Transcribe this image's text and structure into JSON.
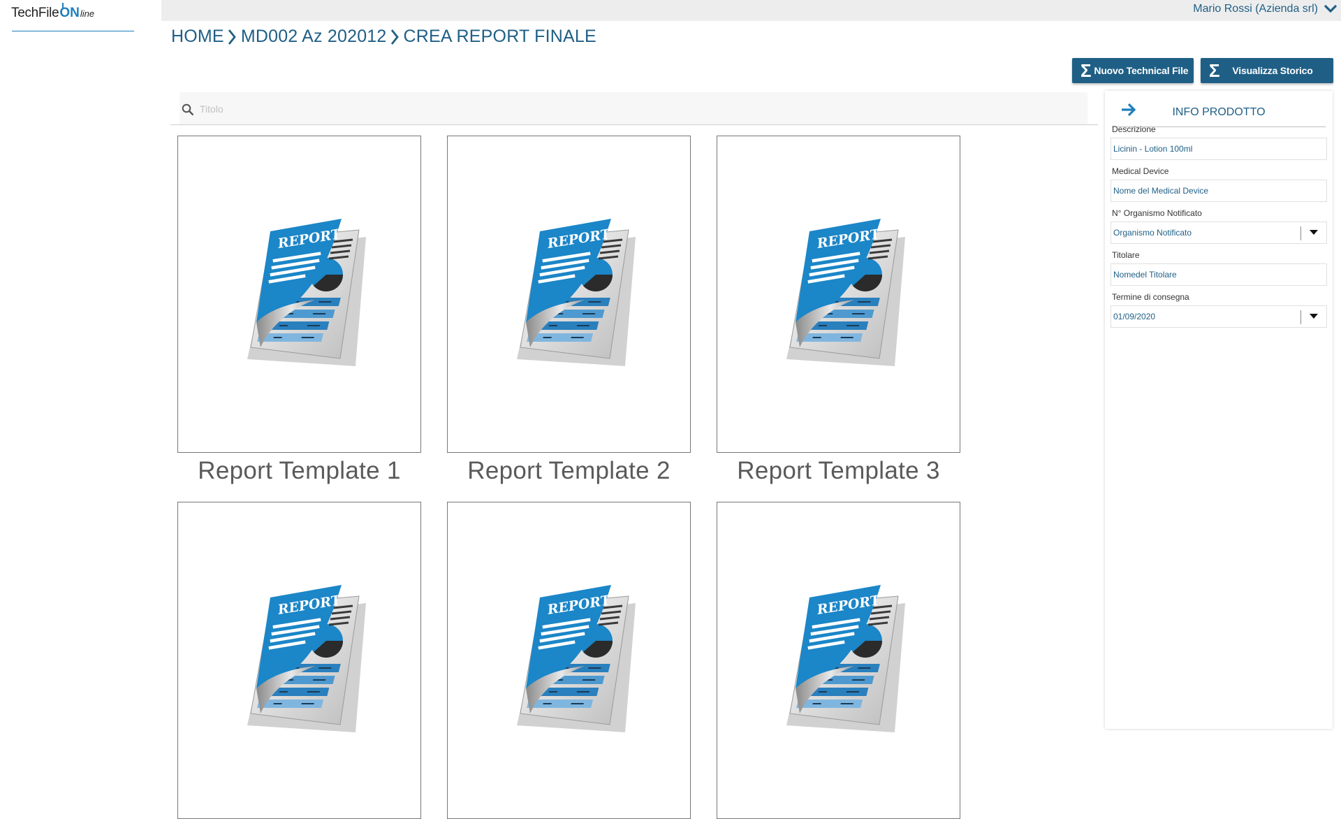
{
  "app": {
    "logo_main": "TechFile",
    "logo_on": "ON",
    "logo_suffix": "line"
  },
  "user": {
    "name": "Mario Rossi (Azienda srl)"
  },
  "breadcrumb": [
    "HOME",
    "MD002 Az 202012",
    "CREA REPORT FINALE"
  ],
  "actions": {
    "new_label": "Nuovo Technical File",
    "history_label": "Visualizza Storico",
    "icon": "Σ"
  },
  "search": {
    "placeholder": "Titolo",
    "value": ""
  },
  "templates": [
    {
      "title": "Report Template 1",
      "cover_text": "REPORT"
    },
    {
      "title": "Report Template 2",
      "cover_text": "REPORT"
    },
    {
      "title": "Report Template 3",
      "cover_text": "REPORT"
    },
    {
      "title": "",
      "cover_text": "REPORT"
    },
    {
      "title": "",
      "cover_text": "REPORT"
    },
    {
      "title": "",
      "cover_text": "REPORT"
    }
  ],
  "panel": {
    "title": "INFO PRODOTTO",
    "fields": [
      {
        "label": "Descrizione",
        "value": "Licinin - Lotion 100ml",
        "type": "text"
      },
      {
        "label": "Medical Device",
        "value": "Nome del Medical Device",
        "type": "text"
      },
      {
        "label": "N° Organismo Notificato",
        "value": "Organismo Notificato",
        "type": "select"
      },
      {
        "label": "Titolare",
        "value": "Nomedel Titolare",
        "type": "text"
      },
      {
        "label": "Termine di consegna",
        "value": "01/09/2020",
        "type": "select"
      }
    ]
  },
  "colors": {
    "brand": "#1f5f86",
    "accent": "#1e7fbd",
    "topbar": "#ededed",
    "report_blue": "#1b86c8"
  }
}
